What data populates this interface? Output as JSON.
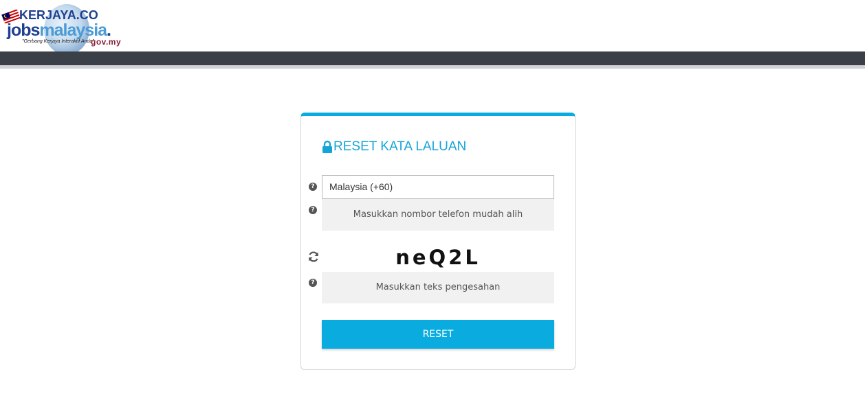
{
  "logo": {
    "brand_top": "KERJAYA.CO",
    "brand_jobs": "jobs",
    "brand_malaysia": "malaysia",
    "brand_dot": ".",
    "tagline": "\"Gerbang Kerjaya Interaktif Anda\"",
    "gov": "gov.my"
  },
  "form": {
    "title": "RESET KATA LALUAN",
    "country_select_value": "Malaysia (+60)",
    "phone_placeholder": "Masukkan nombor telefon mudah alih",
    "captcha_text": "neQ2L",
    "captcha_placeholder": "Masukkan teks pengesahan",
    "reset_label": "RESET"
  },
  "icons": {
    "lock": "lock-icon",
    "help": "help-icon",
    "refresh": "refresh-icon"
  },
  "colors": {
    "accent": "#0aace0",
    "title": "#14a4d8",
    "navbar": "#3b3f48",
    "input_bg": "#f1f1f1"
  }
}
